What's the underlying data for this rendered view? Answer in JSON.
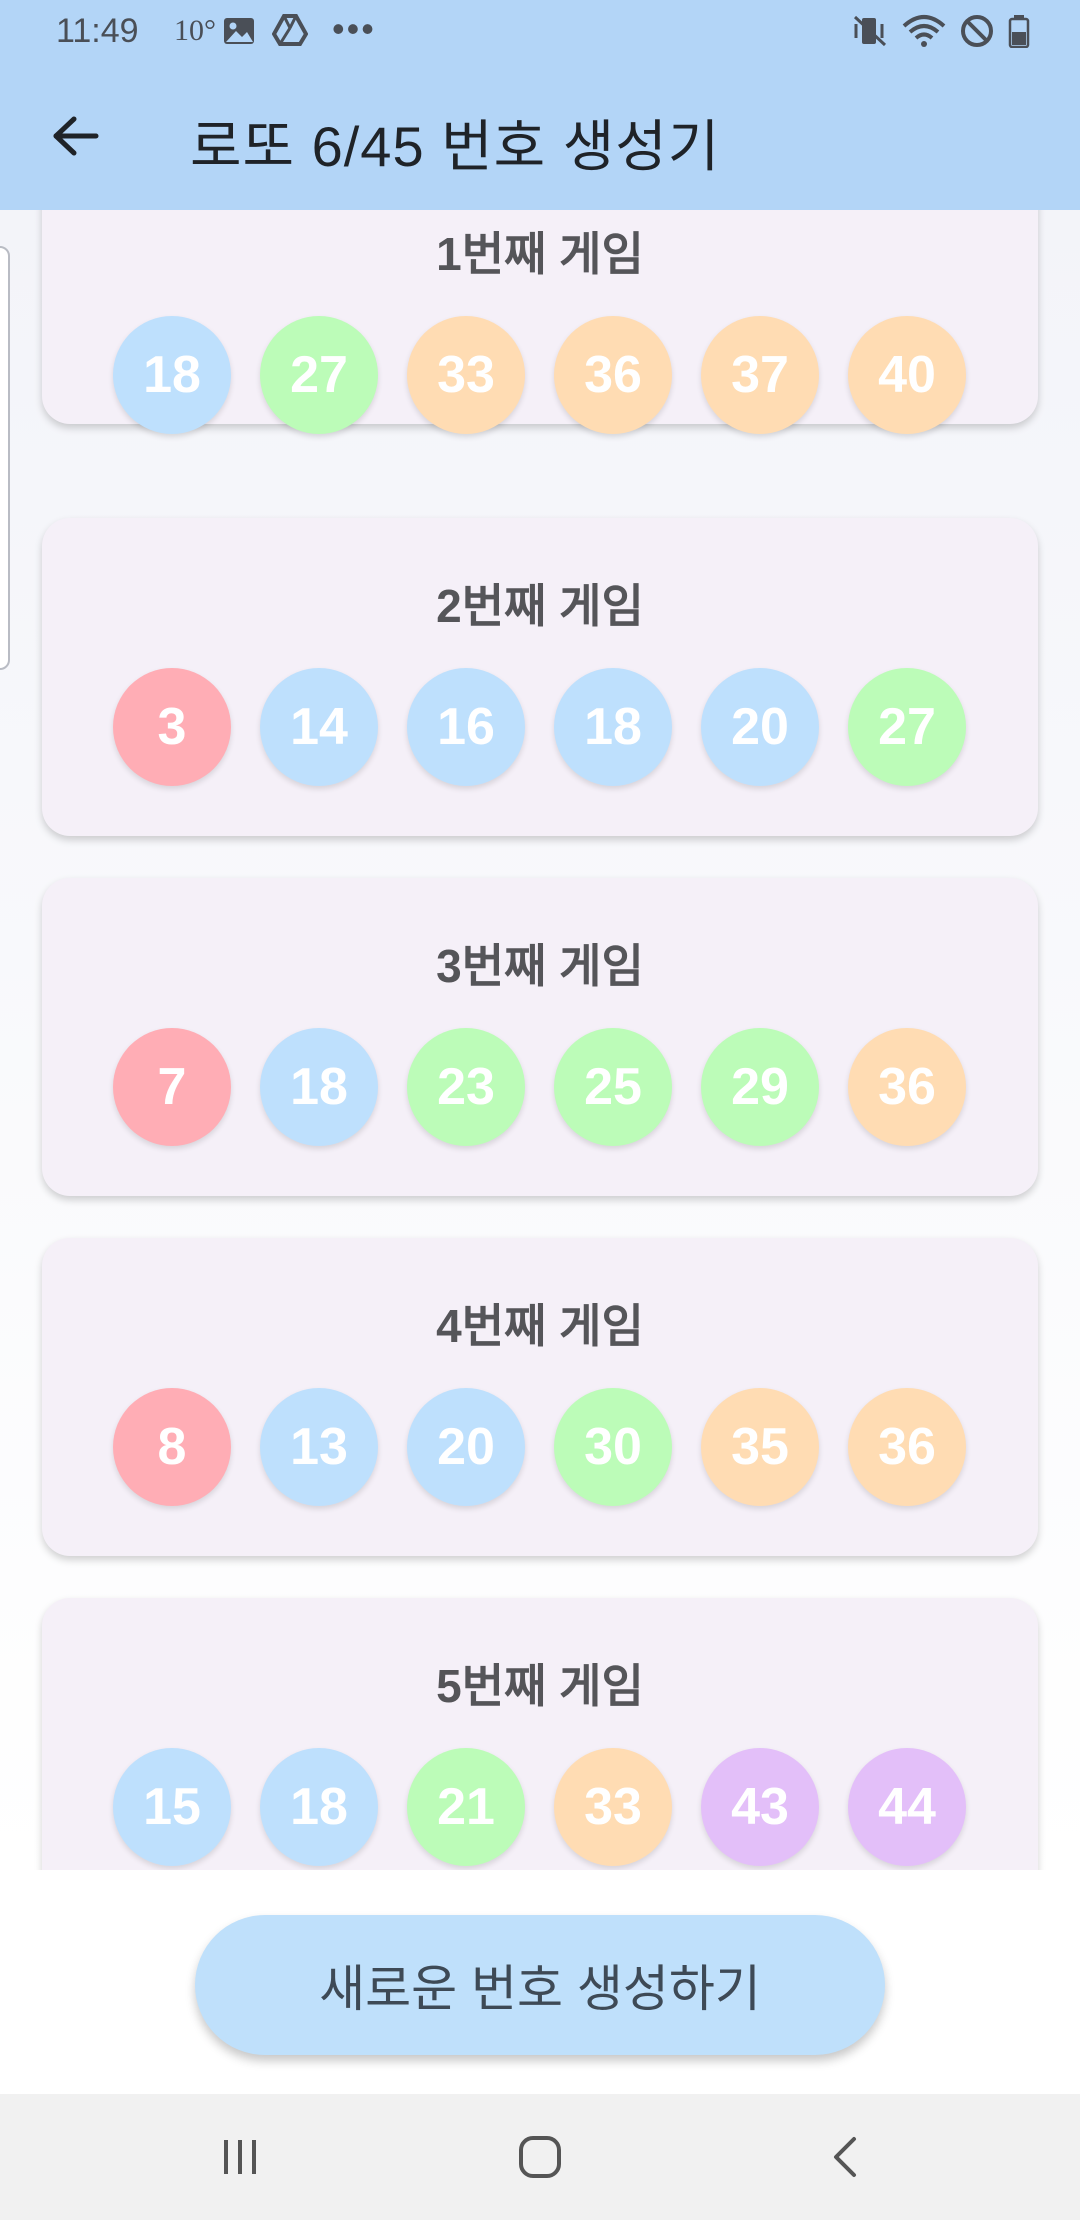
{
  "status_bar": {
    "time": "11:49",
    "temperature": "10°",
    "icons_left": [
      "gallery-icon",
      "drive-icon",
      "more-icon"
    ],
    "icons_right": [
      "vibrate-mute-icon",
      "wifi-icon",
      "do-not-disturb-icon",
      "battery-icon"
    ]
  },
  "app_bar": {
    "back_icon": "arrow-left-icon",
    "title": "로또 6/45 번호 생성기"
  },
  "colors": {
    "header": "#b3d5f7",
    "card_bg": "#f5f0f8",
    "ball_1_10": "#ffadb5",
    "ball_11_20": "#bee0fd",
    "ball_21_30": "#bcfcb8",
    "ball_31_40": "#ffdcb3",
    "ball_41_45": "#e3bff9"
  },
  "games": [
    {
      "title": "1번째 게임",
      "numbers": [
        18,
        27,
        33,
        36,
        37,
        40
      ]
    },
    {
      "title": "2번째 게임",
      "numbers": [
        3,
        14,
        16,
        18,
        20,
        27
      ]
    },
    {
      "title": "3번째 게임",
      "numbers": [
        7,
        18,
        23,
        25,
        29,
        36
      ]
    },
    {
      "title": "4번째 게임",
      "numbers": [
        8,
        13,
        20,
        30,
        35,
        36
      ]
    },
    {
      "title": "5번째 게임",
      "numbers": [
        15,
        18,
        21,
        33,
        43,
        44
      ]
    }
  ],
  "action": {
    "generate_label": "새로운 번호 생성하기"
  },
  "nav_bar": {
    "icons": [
      "recent-apps-icon",
      "home-icon",
      "back-icon"
    ]
  }
}
